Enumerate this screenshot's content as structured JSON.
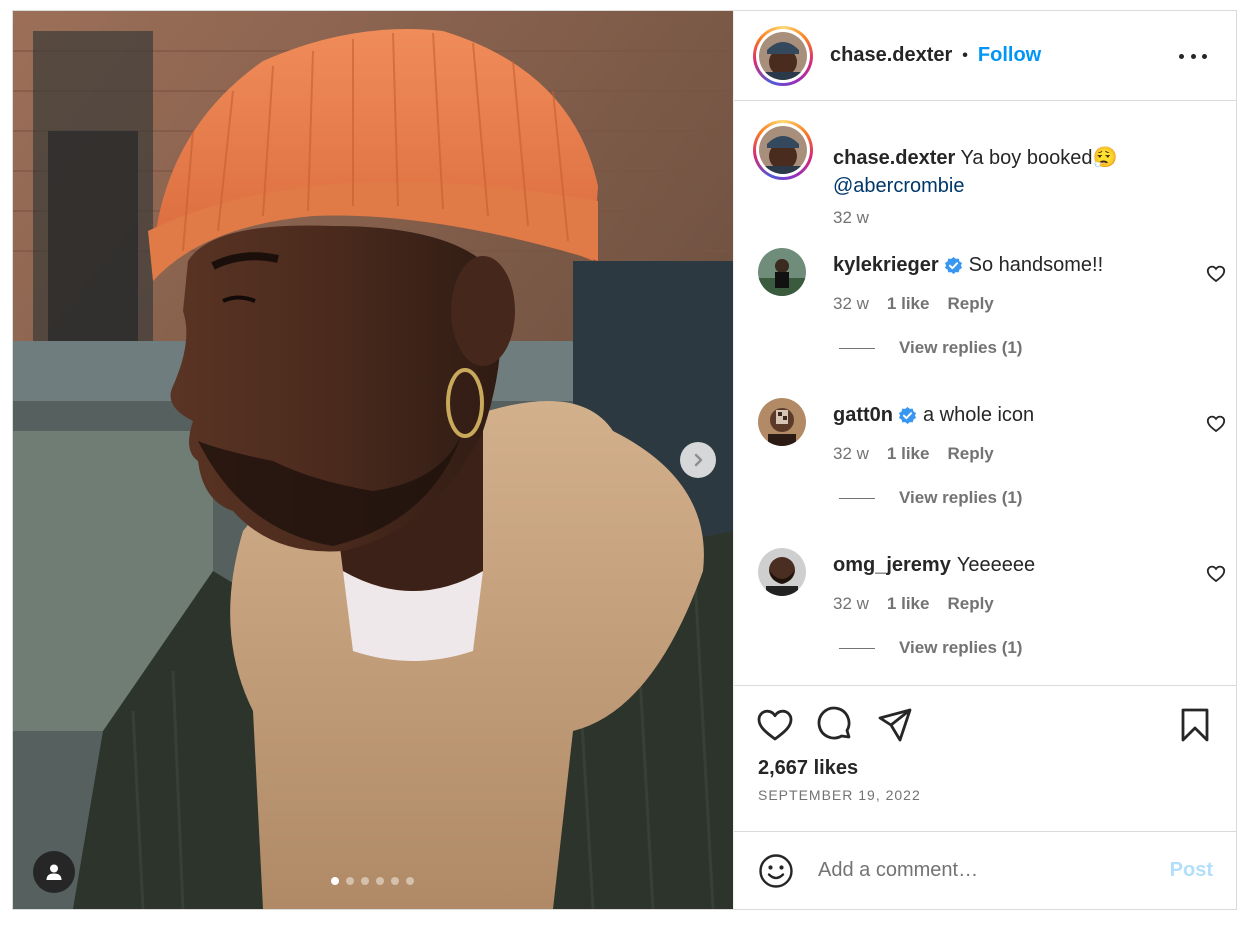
{
  "post": {
    "photo_alt": "",
    "carousel": {
      "count": 6,
      "active_index": 0
    }
  },
  "header": {
    "username": "chase.dexter",
    "separator": "•",
    "follow_label": "Follow",
    "more_icon": "more-horizontal-icon"
  },
  "caption": {
    "username": "chase.dexter",
    "text": " Ya boy booked😮‍💨",
    "mention": "@abercrombie",
    "time": "32 w"
  },
  "comments": [
    {
      "username": "kylekrieger",
      "verified": true,
      "text": "So handsome!!",
      "time": "32 w",
      "likes": "1 like",
      "reply_label": "Reply",
      "view_replies": "View replies (1)"
    },
    {
      "username": "gatt0n",
      "verified": true,
      "text": "a whole icon",
      "time": "32 w",
      "likes": "1 like",
      "reply_label": "Reply",
      "view_replies": "View replies (1)"
    },
    {
      "username": "omg_jeremy",
      "verified": false,
      "text": "Yeeeeee",
      "time": "32 w",
      "likes": "1 like",
      "reply_label": "Reply",
      "view_replies": "View replies (1)"
    }
  ],
  "actions": {
    "icons": [
      "heart-icon",
      "comment-icon",
      "share-icon",
      "bookmark-icon"
    ],
    "likes": "2,667 likes",
    "date": "SEPTEMBER 19, 2022"
  },
  "add_comment": {
    "placeholder": "Add a comment…",
    "post_label": "Post"
  },
  "colors": {
    "link_blue": "#0095f6",
    "mention": "#00376b",
    "muted": "#737373",
    "post_disabled": "#b2dffc",
    "border": "#dbdbdb"
  }
}
